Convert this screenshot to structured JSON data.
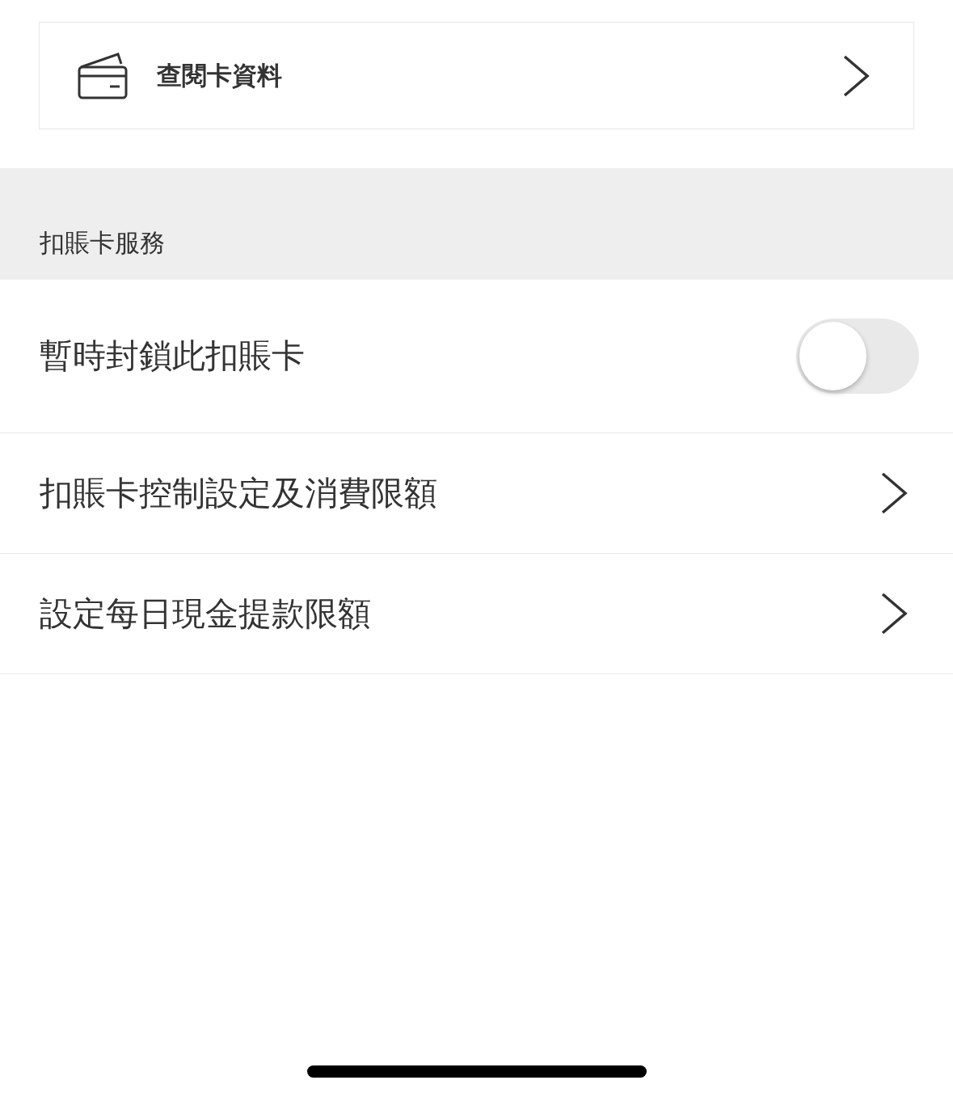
{
  "card_info": {
    "label": "查閱卡資料"
  },
  "section": {
    "title": "扣賬卡服務"
  },
  "rows": [
    {
      "kind": "toggle",
      "label": "暫時封鎖此扣賬卡",
      "on": false
    },
    {
      "kind": "link",
      "label": "扣賬卡控制設定及消費限額"
    },
    {
      "kind": "link",
      "label": "設定每日現金提款限額"
    }
  ]
}
